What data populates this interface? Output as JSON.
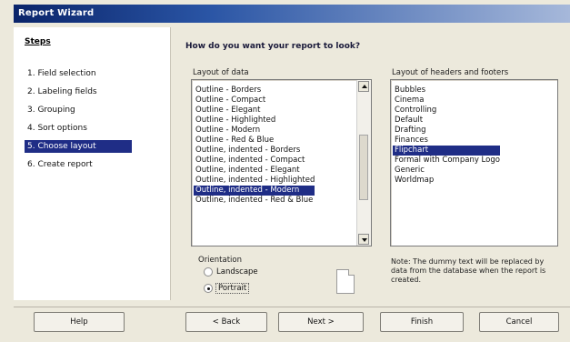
{
  "window": {
    "title": "Report Wizard"
  },
  "steps": {
    "title": "Steps",
    "items": [
      {
        "label": "1. Field selection",
        "active": false
      },
      {
        "label": "2. Labeling fields",
        "active": false
      },
      {
        "label": "3. Grouping",
        "active": false
      },
      {
        "label": "4. Sort options",
        "active": false
      },
      {
        "label": "5. Choose layout",
        "active": true
      },
      {
        "label": "6. Create report",
        "active": false
      }
    ]
  },
  "main": {
    "question": "How do you want your report to look?",
    "layout_data_label": "Layout of data",
    "layout_data_items": [
      "Outline - Borders",
      "Outline - Compact",
      "Outline - Elegant",
      "Outline - Highlighted",
      "Outline - Modern",
      "Outline - Red & Blue",
      "Outline, indented - Borders",
      "Outline, indented - Compact",
      "Outline, indented - Elegant",
      "Outline, indented - Highlighted",
      "Outline, indented - Modern",
      "Outline, indented - Red & Blue"
    ],
    "layout_data_selected": "Outline, indented - Modern",
    "layout_headers_label": "Layout of headers and footers",
    "layout_headers_items": [
      "Bubbles",
      "Cinema",
      "Controlling",
      "Default",
      "Drafting",
      "Finances",
      "Flipchart",
      "Formal with Company Logo",
      "Generic",
      "Worldmap"
    ],
    "layout_headers_selected": "Flipchart",
    "orientation_label": "Orientation",
    "orientation_options": [
      "Landscape",
      "Portrait"
    ],
    "orientation_selected": "Portrait",
    "note": "Note: The dummy text will be replaced by data from the database when the report is created."
  },
  "buttons": {
    "help": "Help",
    "back": "< Back",
    "next": "Next >",
    "finish": "Finish",
    "cancel": "Cancel"
  },
  "colors": {
    "selection": "#1f2d86",
    "titlebar_start": "#0a246a",
    "window_bg": "#ece9dc"
  }
}
